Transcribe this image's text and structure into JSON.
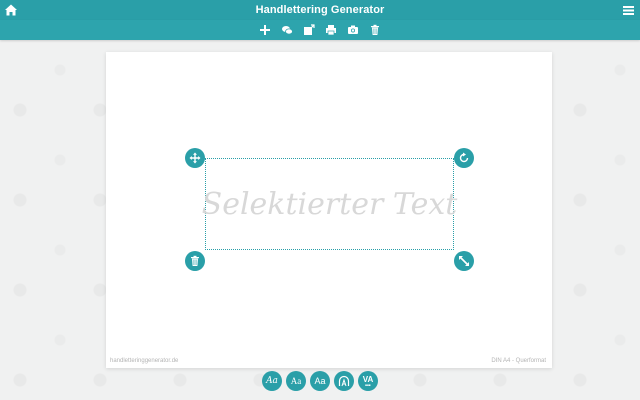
{
  "app": {
    "title": "Handlettering Generator"
  },
  "icons": {
    "home": "home-icon",
    "menu": "hamburger-menu-icon"
  },
  "toolbar": {
    "tools": [
      {
        "name": "add-text",
        "icon": "plus-icon"
      },
      {
        "name": "add-shape",
        "icon": "speech-bubbles-icon"
      },
      {
        "name": "export-file",
        "icon": "file-export-icon"
      },
      {
        "name": "print",
        "icon": "printer-icon"
      },
      {
        "name": "screenshot",
        "icon": "camera-icon"
      },
      {
        "name": "delete-all",
        "icon": "trash-icon"
      }
    ]
  },
  "canvas": {
    "selected_text": "Selektierter Text",
    "footer_left": "handletteringgenerator.de",
    "footer_right": "DIN A4 - Querformat",
    "handles": {
      "top_left": "move-arrows-icon",
      "top_right": "rotate-icon",
      "bottom_left": "trash-icon",
      "bottom_right": "resize-arrows-icon"
    }
  },
  "font_bar": {
    "buttons": [
      {
        "name": "font-script",
        "label": "Aa"
      },
      {
        "name": "font-serif",
        "label": "Aa"
      },
      {
        "name": "font-sans",
        "label": "Aa"
      },
      {
        "name": "font-shape",
        "icon": "arch-text-icon"
      },
      {
        "name": "letter-spacing",
        "label": "VA",
        "sublabel": "■■■"
      }
    ]
  },
  "colors": {
    "accent": "#2a9fa8",
    "background": "#f0f1f1",
    "canvas": "#ffffff",
    "placeholder_text": "#d8d8d8"
  }
}
